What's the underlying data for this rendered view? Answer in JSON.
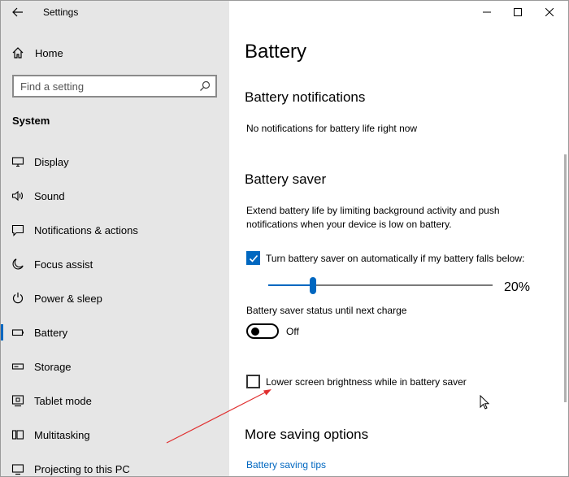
{
  "window": {
    "title": "Settings",
    "controls": [
      "minimize",
      "maximize",
      "close"
    ]
  },
  "sidebar": {
    "home_label": "Home",
    "search_placeholder": "Find a setting",
    "section_header": "System",
    "items": [
      {
        "label": "Display",
        "icon": "display-icon",
        "active": false
      },
      {
        "label": "Sound",
        "icon": "sound-icon",
        "active": false
      },
      {
        "label": "Notifications & actions",
        "icon": "notifications-icon",
        "active": false
      },
      {
        "label": "Focus assist",
        "icon": "moon-icon",
        "active": false
      },
      {
        "label": "Power & sleep",
        "icon": "power-icon",
        "active": false
      },
      {
        "label": "Battery",
        "icon": "battery-icon",
        "active": true
      },
      {
        "label": "Storage",
        "icon": "storage-icon",
        "active": false
      },
      {
        "label": "Tablet mode",
        "icon": "tablet-icon",
        "active": false
      },
      {
        "label": "Multitasking",
        "icon": "multitasking-icon",
        "active": false
      },
      {
        "label": "Projecting to this PC",
        "icon": "projecting-icon",
        "active": false
      }
    ]
  },
  "main": {
    "title": "Battery",
    "notifications": {
      "heading": "Battery notifications",
      "text": "No notifications for battery life right now"
    },
    "saver": {
      "heading": "Battery saver",
      "description_line1": "Extend battery life by limiting background activity and push",
      "description_line2": "notifications when your device is low on battery.",
      "auto_checkbox_label": "Turn battery saver on automatically if my battery falls below:",
      "auto_checked": true,
      "threshold_percent": 20,
      "threshold_label": "20%",
      "status_label": "Battery saver status until next charge",
      "status_toggle": "Off",
      "status_on": false,
      "brightness_checkbox_label": "Lower screen brightness while in battery saver",
      "brightness_checked": false
    },
    "more": {
      "heading": "More saving options",
      "tips_link": "Battery saving tips"
    }
  },
  "colors": {
    "accent": "#0067c0",
    "sidebar_bg": "#e6e6e6",
    "annotation_arrow": "#e03030"
  }
}
